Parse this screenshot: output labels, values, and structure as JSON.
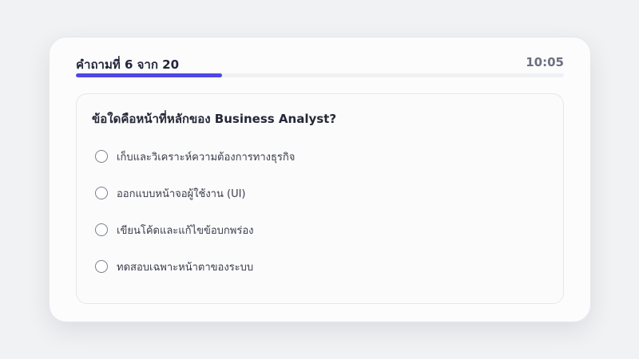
{
  "quiz": {
    "counter_label": "คำถามที่ 6 จาก 20",
    "timer": "10:05",
    "progress": 0.3,
    "question": "ข้อใดคือหน้าที่หลักของ Business Analyst?",
    "options": [
      {
        "label": "เก็บและวิเคราะห์ความต้องการทางธุรกิจ",
        "selected": false
      },
      {
        "label": "ออกแบบหน้าจอผู้ใช้งาน (UI)",
        "selected": false
      },
      {
        "label": "เขียนโค้ดและแก้ไขข้อบกพร่อง",
        "selected": false
      },
      {
        "label": "ทดสอบเฉพาะหน้าตาของระบบ",
        "selected": false
      }
    ]
  },
  "colors": {
    "accent": "#4f46e5",
    "page_background": "#f1f2f4",
    "card_background": "#fcfcfc"
  }
}
